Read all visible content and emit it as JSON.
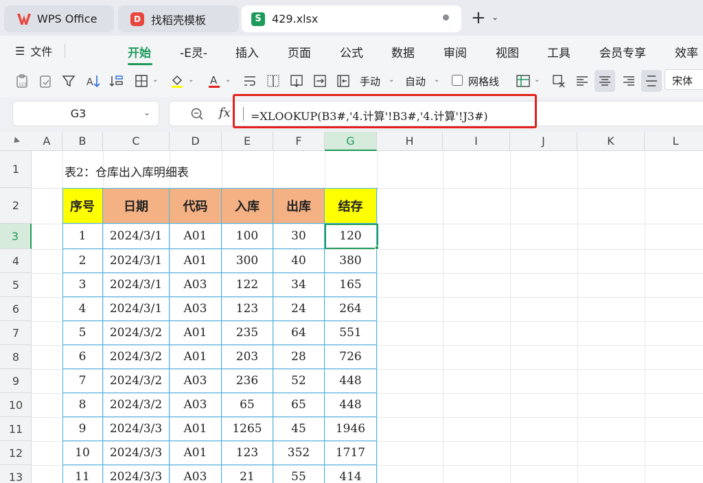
{
  "tabs": {
    "wps": "WPS Office",
    "template": "找稻壳模板",
    "file": "429.xlsx",
    "file_logo": "S",
    "template_logo": "D"
  },
  "menu": {
    "file_label": "文件",
    "items": [
      "开始",
      "-E灵-",
      "插入",
      "页面",
      "公式",
      "数据",
      "审阅",
      "视图",
      "工具",
      "会员专享",
      "效率"
    ]
  },
  "toolbar": {
    "manual_label": "手动",
    "auto_label": "自动",
    "gridlines_label": "网格线",
    "font_name": "宋体"
  },
  "formula_bar": {
    "cell_ref": "G3",
    "fx_label": "fx",
    "formula": "=XLOOKUP(B3#,'4.计算'!B3#,'4.计算'!J3#)"
  },
  "grid": {
    "columns": [
      "A",
      "B",
      "C",
      "D",
      "E",
      "F",
      "G",
      "H",
      "I",
      "J",
      "K",
      "L"
    ],
    "rows": [
      "1",
      "2",
      "3",
      "4",
      "5",
      "6",
      "7",
      "8",
      "9",
      "10",
      "11",
      "12",
      "13"
    ],
    "selected_column": "G",
    "selected_row": "3"
  },
  "sheet": {
    "title": "表2：仓库出入库明细表",
    "headers": [
      "序号",
      "日期",
      "代码",
      "入库",
      "出库",
      "结存"
    ],
    "rows": [
      [
        "1",
        "2024/3/1",
        "A01",
        "100",
        "30",
        "120"
      ],
      [
        "2",
        "2024/3/1",
        "A01",
        "300",
        "40",
        "380"
      ],
      [
        "3",
        "2024/3/1",
        "A03",
        "122",
        "34",
        "165"
      ],
      [
        "4",
        "2024/3/1",
        "A03",
        "123",
        "24",
        "264"
      ],
      [
        "5",
        "2024/3/2",
        "A01",
        "235",
        "64",
        "551"
      ],
      [
        "6",
        "2024/3/2",
        "A01",
        "203",
        "28",
        "726"
      ],
      [
        "7",
        "2024/3/2",
        "A03",
        "236",
        "52",
        "448"
      ],
      [
        "8",
        "2024/3/2",
        "A03",
        "65",
        "65",
        "448"
      ],
      [
        "9",
        "2024/3/3",
        "A01",
        "1265",
        "45",
        "1946"
      ],
      [
        "10",
        "2024/3/3",
        "A01",
        "123",
        "352",
        "1717"
      ],
      [
        "11",
        "2024/3/3",
        "A03",
        "21",
        "55",
        "414"
      ]
    ]
  },
  "colors": {
    "accent": "#1e9a5b",
    "highlight_box": "#e3201b",
    "header_yellow": "#ffff00",
    "header_orange": "#f4b183",
    "table_border": "#49b5e3"
  }
}
